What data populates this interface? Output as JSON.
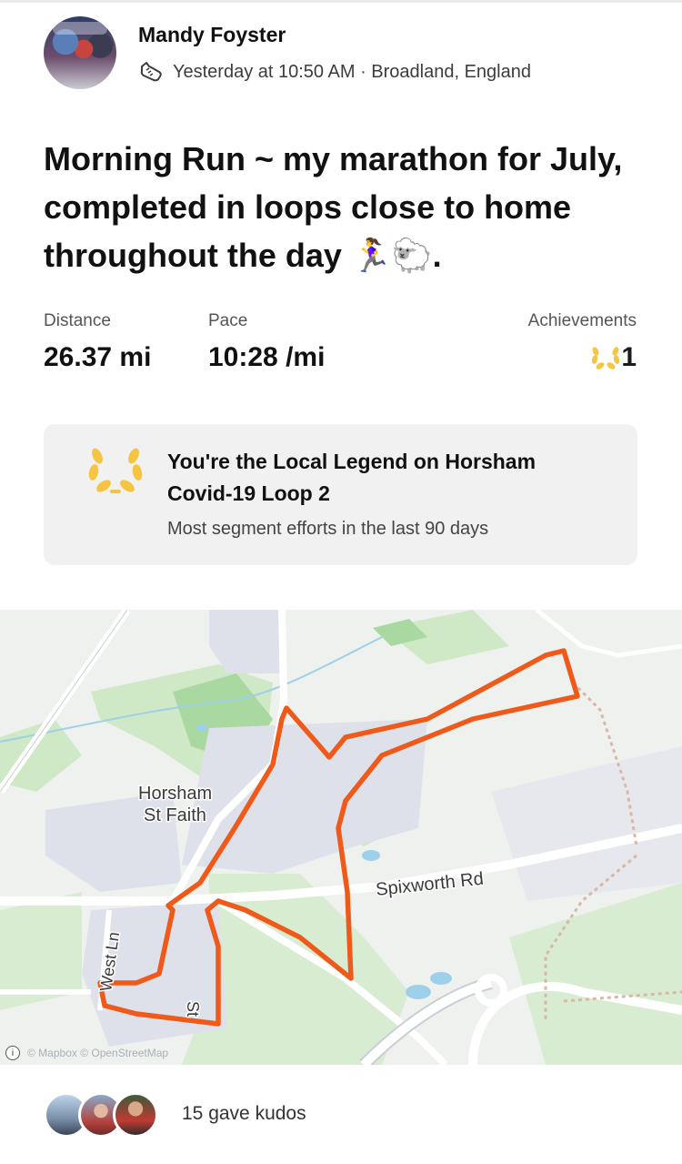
{
  "post": {
    "author": "Mandy Foyster",
    "activity_icon": "running-shoe-icon",
    "meta": "Yesterday at 10:50 AM · Broadland, England",
    "title": "Morning Run ~ my marathon for July, completed in loops close to home throughout the day 🏃‍♀️🐑."
  },
  "stats": {
    "distance_label": "Distance",
    "distance_value": "26.37 mi",
    "pace_label": "Pace",
    "pace_value": "10:28 /mi",
    "achievements_label": "Achievements",
    "achievements_value": "1",
    "achievement_icon": "laurel-icon"
  },
  "legend": {
    "heading": "You're the Local Legend on Horsham Covid-19 Loop 2",
    "subtext": "Most segment efforts in the last 90 days",
    "icon": "laurel-icon",
    "color": "#f5c542"
  },
  "map": {
    "place_label_line1": "Horsham",
    "place_label_line2": "St Faith",
    "road_spixworth": "Spixworth Rd",
    "road_west_ln": "West Ln",
    "road_st": "St",
    "attribution": "© Mapbox © OpenStreetMap",
    "route_color": "#ef5a1a"
  },
  "kudos": {
    "text": "15 gave kudos"
  }
}
